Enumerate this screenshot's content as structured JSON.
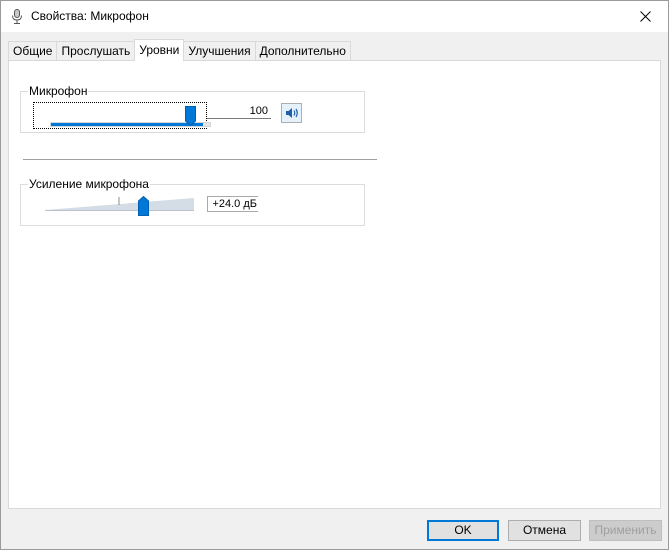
{
  "window": {
    "title": "Свойства: Микрофон",
    "title_icon": "microphone-icon",
    "close_icon": "close-icon"
  },
  "tabs": [
    {
      "label": "Общие",
      "active": false
    },
    {
      "label": "Прослушать",
      "active": false
    },
    {
      "label": "Уровни",
      "active": true
    },
    {
      "label": "Улучшения",
      "active": false
    },
    {
      "label": "Дополнительно",
      "active": false
    }
  ],
  "microphone": {
    "label": "Микрофон",
    "value": "100",
    "level_percent": 100,
    "mute_icon": "speaker-icon"
  },
  "boost": {
    "label": "Усиление микрофона",
    "value": "+24.0 дБ",
    "level_fraction": 0.66
  },
  "buttons": {
    "ok": "OK",
    "cancel": "Отмена",
    "apply": "Применить"
  },
  "colors": {
    "accent": "#0078d7"
  }
}
